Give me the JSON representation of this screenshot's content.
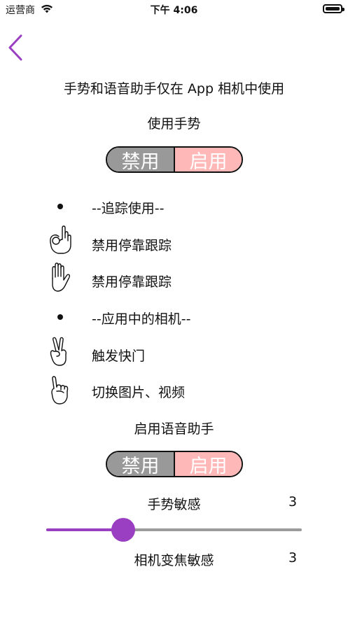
{
  "status_bar": {
    "carrier": "运营商",
    "time": "下午 4:06"
  },
  "colors": {
    "accent": "#9a3fc1",
    "toggle_off": "#999999",
    "toggle_on": "#ffb8b8"
  },
  "info_text": "手势和语音助手仅在 App 相机中使用",
  "gesture": {
    "title": "使用手势",
    "disable_label": "禁用",
    "enable_label": "启用"
  },
  "list": {
    "section1": "--追踪使用--",
    "item1": {
      "icon": "ok-hand-icon",
      "label": "禁用停靠跟踪"
    },
    "item2": {
      "icon": "open-palm-icon",
      "label": "禁用停靠跟踪"
    },
    "section2": "--应用中的相机--",
    "item3": {
      "icon": "victory-hand-icon",
      "label": "触发快门"
    },
    "item4": {
      "icon": "pinky-thumb-hand-icon",
      "label": "切换图片、视频"
    }
  },
  "voice": {
    "title": "启用语音助手",
    "disable_label": "禁用",
    "enable_label": "启用"
  },
  "gesture_sensitivity": {
    "label": "手势敏感",
    "value": "3",
    "level": 0.3
  },
  "camera_zoom_sensitivity": {
    "label": "相机变焦敏感",
    "value": "3"
  }
}
